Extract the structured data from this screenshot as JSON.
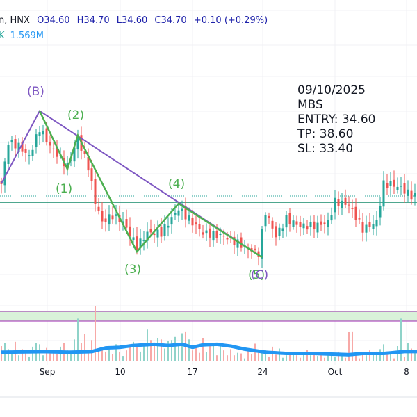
{
  "header": {
    "symbol_tail": "n, HNX",
    "open": "O34.60",
    "high": "H34.70",
    "low": "L34.60",
    "close": "C34.70",
    "change": "+0.10 (+0.29%)",
    "vol_label": "K",
    "vol_value": "1.569M"
  },
  "annotation": {
    "date": "09/10/2025",
    "ticker": "MBS",
    "entry": "ENTRY: 34.60",
    "tp": "TP: 38.60",
    "sl": "SL: 33.40"
  },
  "wave_labels": {
    "B": "(B)",
    "w1": "(1)",
    "w2": "(2)",
    "w3": "(3)",
    "w4": "(4)",
    "w5": "(5)",
    "C": "(C)"
  },
  "colors": {
    "up": "#26a69a",
    "down": "#ef5350",
    "wave_green": "#4caf50",
    "wave_purple": "#7e57c2",
    "vol_ma": "#2196f3"
  },
  "chart_data": {
    "type": "candlestick",
    "x_ticks": [
      "Sep",
      "10",
      "17",
      "24",
      "Oct",
      "8"
    ],
    "price_range": [
      33.3,
      37.2
    ],
    "entry_line": 34.6,
    "last_price": 34.7,
    "close_keypoints": [
      [
        0,
        34.89
      ],
      [
        2,
        35.56
      ],
      [
        5,
        35.5
      ],
      [
        8,
        35.33
      ],
      [
        11,
        35.78
      ],
      [
        14,
        35.5
      ],
      [
        19,
        35.17
      ],
      [
        22,
        35.61
      ],
      [
        25,
        35.17
      ],
      [
        27,
        34.61
      ],
      [
        29,
        34.28
      ],
      [
        32,
        34.39
      ],
      [
        35,
        34.28
      ],
      [
        39,
        33.89
      ],
      [
        42,
        34.11
      ],
      [
        46,
        34.11
      ],
      [
        51,
        34.5
      ],
      [
        54,
        34.33
      ],
      [
        58,
        34.11
      ],
      [
        64,
        34.06
      ],
      [
        70,
        33.89
      ],
      [
        74,
        33.78
      ],
      [
        76,
        34.44
      ],
      [
        79,
        34.06
      ],
      [
        82,
        34.33
      ],
      [
        86,
        34.22
      ],
      [
        90,
        34.22
      ],
      [
        94,
        34.28
      ],
      [
        96,
        34.61
      ],
      [
        100,
        34.56
      ],
      [
        104,
        34.17
      ],
      [
        108,
        34.28
      ],
      [
        110,
        34.89
      ],
      [
        112,
        34.89
      ],
      [
        115,
        34.83
      ],
      [
        118,
        34.7
      ],
      [
        120,
        34.7
      ]
    ],
    "wave_purple": [
      [
        0,
        34.9
      ],
      [
        11,
        36.06
      ],
      [
        75,
        33.72
      ]
    ],
    "wave_green": [
      [
        11,
        36.06
      ],
      [
        19,
        35.13
      ],
      [
        22,
        35.67
      ],
      [
        39,
        33.81
      ],
      [
        51,
        34.58
      ],
      [
        75,
        33.72
      ]
    ],
    "volume_m": [
      2.5,
      3,
      2,
      1.5,
      3.2,
      1,
      2,
      1.6,
      0.8,
      2.4,
      3,
      2.8,
      1,
      2.2,
      1.3,
      1.6,
      1.2,
      2.4,
      3,
      1.8,
      1.6,
      3.6,
      7,
      3,
      4.5,
      1.5,
      3.5,
      9,
      1.8,
      2.2,
      1.6,
      2.5,
      1.2,
      2.8,
      1.6,
      0.9,
      1.8,
      2.6,
      3.2,
      2.8,
      1.6,
      2.7,
      5.2,
      3.5,
      2.6,
      3.8,
      3.6,
      2.1,
      3.3,
      3.5,
      4,
      2.5,
      4.6,
      4.9,
      3.6,
      1.8,
      2.6,
      1.4,
      3.8,
      1.5,
      3,
      2.5,
      1,
      2.7,
      1.8,
      1,
      2,
      1,
      1.4,
      1.3,
      0.5,
      1.8,
      1.2,
      2.9,
      1.7,
      1.5,
      1.9,
      0.8,
      2.4,
      1.1,
      2.1,
      0.6,
      1,
      1.5,
      1.4,
      1,
      0.6,
      1.3,
      1.9,
      1,
      1.4,
      0.9,
      1.2,
      0.6,
      1.1,
      1,
      0.7,
      1.6,
      1.3,
      0.6,
      4.8,
      4.9,
      1,
      0.5,
      1.2,
      1,
      1.8,
      1.5,
      1.6,
      2,
      2.8,
      1.2,
      1.4,
      0.5,
      2.5,
      7,
      0.8,
      3,
      2.1,
      1.6,
      4.9
    ],
    "volume_ma_keypoints": [
      [
        0,
        1.5
      ],
      [
        12,
        1.6
      ],
      [
        20,
        1.5
      ],
      [
        26,
        1.6
      ],
      [
        30,
        2.2
      ],
      [
        34,
        2.3
      ],
      [
        38,
        2.6
      ],
      [
        44,
        2.8
      ],
      [
        48,
        2.6
      ],
      [
        52,
        2.8
      ],
      [
        55,
        2.3
      ],
      [
        58,
        2.7
      ],
      [
        62,
        2.8
      ],
      [
        66,
        2.5
      ],
      [
        70,
        2
      ],
      [
        76,
        1.5
      ],
      [
        82,
        1.3
      ],
      [
        90,
        1.3
      ],
      [
        100,
        1.1
      ],
      [
        104,
        1.3
      ],
      [
        110,
        1.3
      ],
      [
        116,
        1.6
      ],
      [
        120,
        1.6
      ]
    ]
  }
}
